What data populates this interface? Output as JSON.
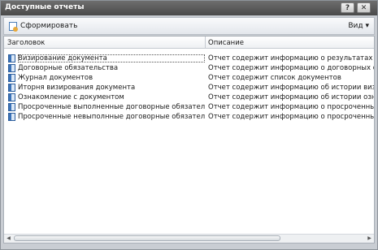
{
  "window": {
    "title": "Доступные отчеты",
    "help_label": "?",
    "close_label": "✕"
  },
  "toolbar": {
    "generate_label": "Сформировать",
    "view_label": "Вид ▾"
  },
  "table": {
    "columns": [
      "Заголовок",
      "Описание"
    ],
    "rows": [
      {
        "title": "Визирование документа",
        "description": "Отчет содержит информацию о результатах визиро"
      },
      {
        "title": "Договорные обязательства",
        "description": "Отчет содержит информацию о договорных обязат"
      },
      {
        "title": "Журнал документов",
        "description": "Отчет содержит список документов"
      },
      {
        "title": "Иторня визирования документа",
        "description": "Отчет содержит информацию об истории визировани"
      },
      {
        "title": "Ознакомление с документом",
        "description": "Отчет содержит информацию об истории ознакомл"
      },
      {
        "title": "Просроченные выполненные договорные обязательства",
        "description": "Отчет содержит информацию о просроченных выпол"
      },
      {
        "title": "Просроченные невыполнные договорные обязательства",
        "description": "Отчет содержит информацию о просроченных невы"
      }
    ]
  }
}
